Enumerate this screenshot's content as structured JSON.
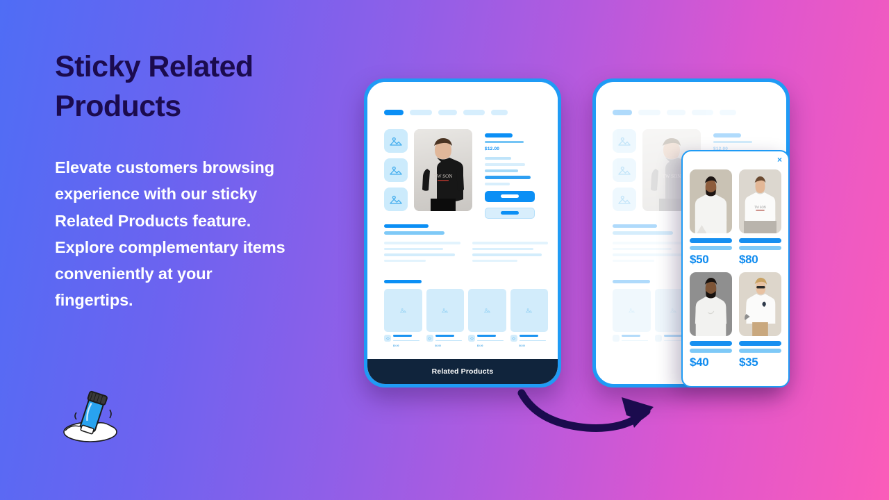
{
  "background": {
    "gradient_from": "#4f6df5",
    "gradient_mid": "#a55ce3",
    "gradient_to": "#fb5cb9"
  },
  "accent": {
    "blue": "#0b8ff5",
    "frame_blue": "#1f9bf5",
    "navy": "#1b0b4e",
    "dark_bar": "#10243c"
  },
  "left_panel": {
    "headline": "Sticky Related Products",
    "body": "Elevate customers browsing experience with our sticky Related Products feature. Explore complementary items conveniently at your fingertips.",
    "logo_name": "glue-stick-logo"
  },
  "phone_one": {
    "nav_pills": [
      "active",
      "idle",
      "idle",
      "idle",
      "idle"
    ],
    "thumbnails": [
      "image-placeholder-icon",
      "image-placeholder-icon",
      "image-placeholder-icon"
    ],
    "hero_image_alt": "man-in-black-tshirt",
    "product_price": "$12.00",
    "primary_cta": "add-to-cart",
    "secondary_cta": "buy-now",
    "related_cards": [
      {
        "price": "$0.00"
      },
      {
        "price": "$0.00"
      },
      {
        "price": "$0.00"
      },
      {
        "price": "$0.00"
      }
    ],
    "sticky_bar_label": "Related Products"
  },
  "phone_two": {
    "nav_pills": [
      "active",
      "idle",
      "idle",
      "idle",
      "idle"
    ],
    "thumbnails": [
      "image-placeholder-icon",
      "image-placeholder-icon",
      "image-placeholder-icon"
    ],
    "hero_image_alt": "man-in-tshirt-dimmed",
    "product_price": "$12.00",
    "dimmed": true
  },
  "popup": {
    "close_label": "×",
    "products": [
      {
        "image_alt": "bearded-man-white-tshirt",
        "price": "$50"
      },
      {
        "image_alt": "young-man-white-tshirt",
        "price": "$80"
      },
      {
        "image_alt": "man-grey-backdrop-white-tshirt",
        "price": "$40"
      },
      {
        "image_alt": "person-sunglasses-white-tshirt",
        "price": "$35"
      }
    ]
  },
  "arrow": {
    "name": "curved-arrow-right"
  }
}
